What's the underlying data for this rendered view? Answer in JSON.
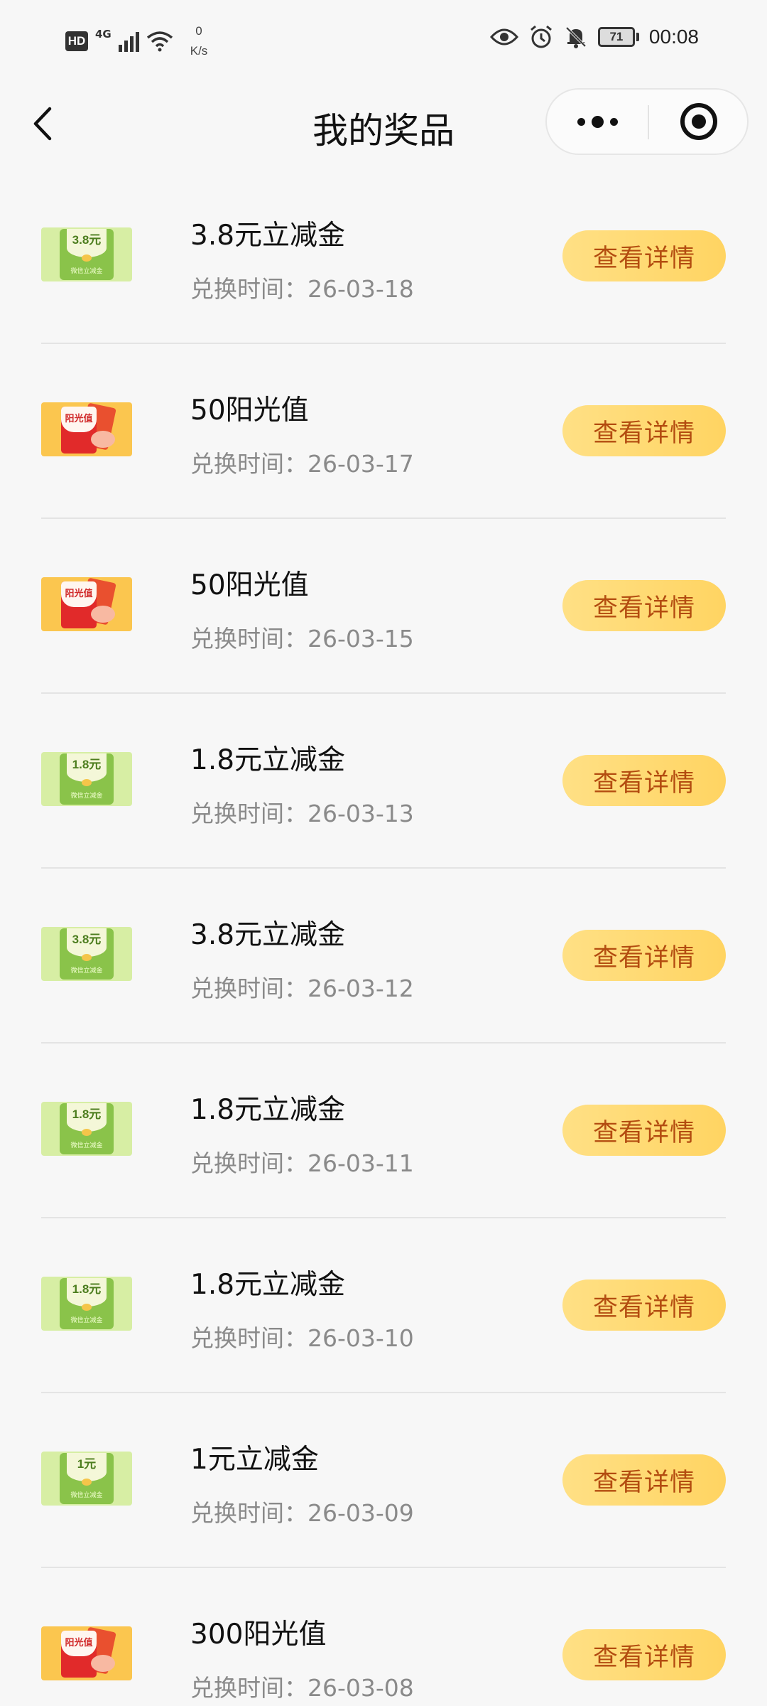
{
  "status_bar": {
    "hd": "HD",
    "network": "4G",
    "speed_value": "0",
    "speed_unit": "K/s",
    "battery": "71",
    "time": "00:08"
  },
  "nav": {
    "title": "我的奖品"
  },
  "prizes": [
    {
      "name": "3.8元立减金",
      "time": "兑换时间：26-03-18",
      "button": "查看详情",
      "thumb_text": "3.8元",
      "thumb_sub": "微信立减金"
    },
    {
      "name": "50阳光值",
      "time": "兑换时间：26-03-17",
      "button": "查看详情",
      "thumb_text": "阳光值"
    },
    {
      "name": "50阳光值",
      "time": "兑换时间：26-03-15",
      "button": "查看详情",
      "thumb_text": "阳光值"
    },
    {
      "name": "1.8元立减金",
      "time": "兑换时间：26-03-13",
      "button": "查看详情",
      "thumb_text": "1.8元",
      "thumb_sub": "微信立减金"
    },
    {
      "name": "3.8元立减金",
      "time": "兑换时间：26-03-12",
      "button": "查看详情",
      "thumb_text": "3.8元",
      "thumb_sub": "微信立减金"
    },
    {
      "name": "1.8元立减金",
      "time": "兑换时间：26-03-11",
      "button": "查看详情",
      "thumb_text": "1.8元",
      "thumb_sub": "微信立减金"
    },
    {
      "name": "1.8元立减金",
      "time": "兑换时间：26-03-10",
      "button": "查看详情",
      "thumb_text": "1.8元",
      "thumb_sub": "微信立减金"
    },
    {
      "name": "1元立减金",
      "time": "兑换时间：26-03-09",
      "button": "查看详情",
      "thumb_text": "1元",
      "thumb_sub": "微信立减金"
    },
    {
      "name": "300阳光值",
      "time": "兑换时间：26-03-08",
      "button": "查看详情",
      "thumb_text": "阳光值"
    }
  ],
  "colors": {
    "background": "#f7f7f7",
    "button_bg": "#ffd96f",
    "button_text": "#b34c10",
    "secondary_text": "#8a8a8a",
    "green_thumb": "#8ac34a",
    "orange_thumb": "#fbc64f"
  },
  "icons": {
    "back": "chevron-left-icon",
    "more": "more-dots-icon",
    "close": "target-close-icon"
  }
}
